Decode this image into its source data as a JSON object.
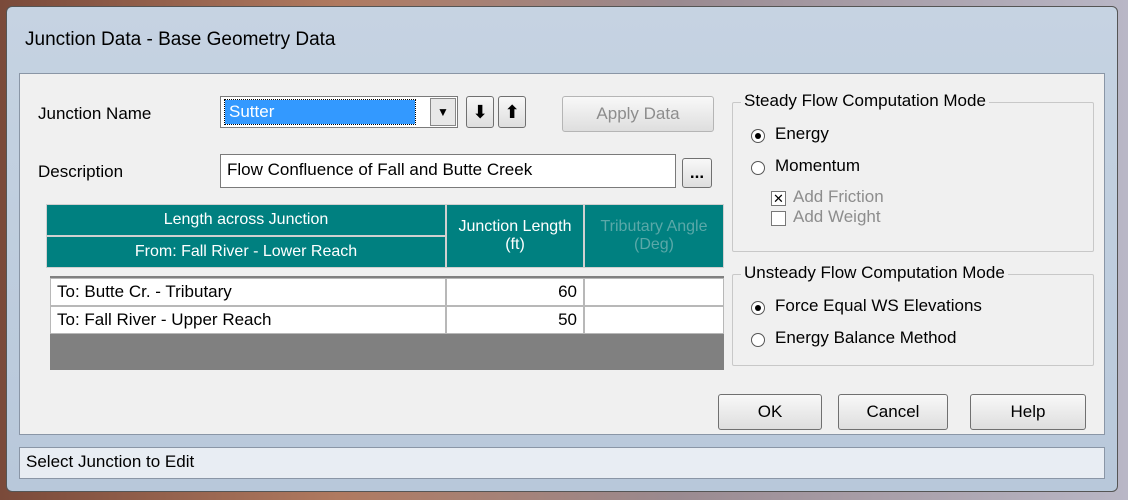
{
  "window": {
    "title": "Junction Data - Base Geometry Data"
  },
  "junction_name": {
    "label": "Junction Name",
    "value": "Sutter"
  },
  "buttons": {
    "apply": "Apply Data",
    "ellipsis": "...",
    "ok": "OK",
    "cancel": "Cancel",
    "help": "Help"
  },
  "description": {
    "label": "Description",
    "value": "Flow Confluence of Fall and Butte Creek"
  },
  "grid": {
    "header_length": "Length across Junction",
    "header_from": "From: Fall River - Lower Reach",
    "header_junction_length": "Junction Length (ft)",
    "header_tributary": "Tributary Angle (Deg)",
    "rows": [
      {
        "to": "To: Butte Cr. - Tributary",
        "length": "60",
        "angle": ""
      },
      {
        "to": "To: Fall River - Upper Reach",
        "length": "50",
        "angle": ""
      }
    ]
  },
  "steady": {
    "title": "Steady Flow Computation Mode",
    "energy": "Energy",
    "momentum": "Momentum",
    "add_friction": "Add Friction",
    "add_weight": "Add Weight",
    "selected": "Energy",
    "add_friction_checked": true,
    "add_weight_checked": false
  },
  "unsteady": {
    "title": "Unsteady Flow Computation Mode",
    "force_equal": "Force Equal WS Elevations",
    "energy_balance": "Energy Balance Method",
    "selected": "Force Equal WS Elevations"
  },
  "status": {
    "text": "Select Junction to Edit"
  }
}
